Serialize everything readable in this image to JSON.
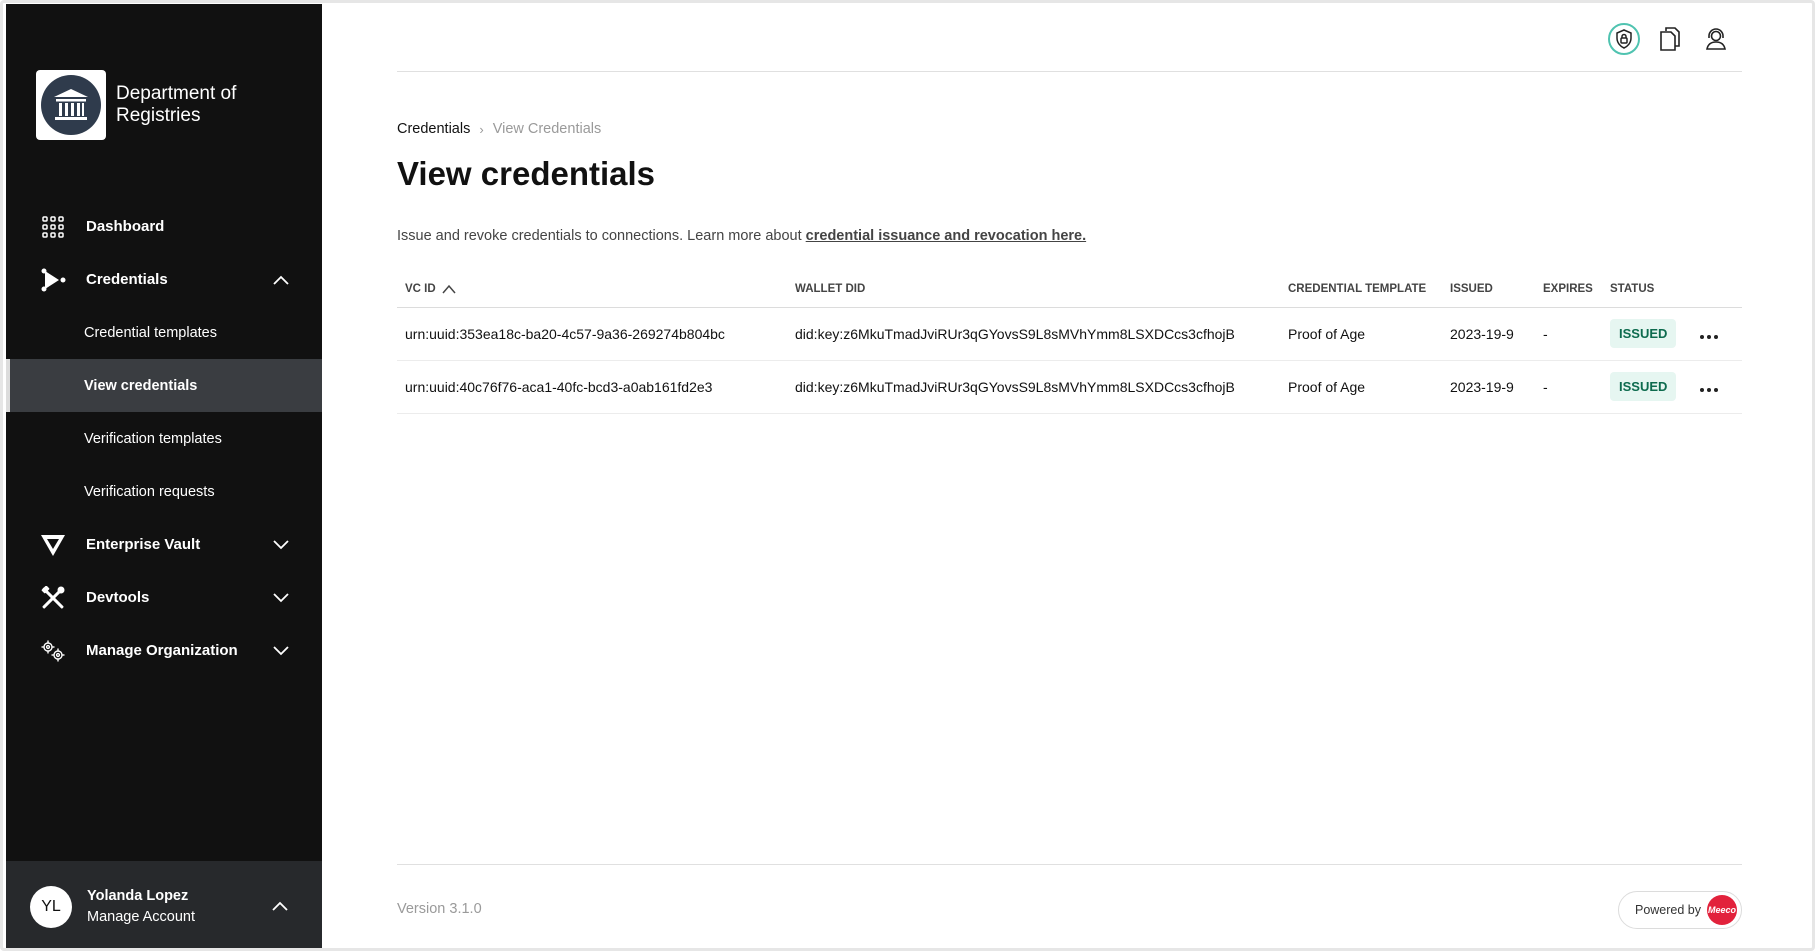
{
  "sidebar": {
    "org_name": "Department of Registries",
    "nav": {
      "dashboard": "Dashboard",
      "credentials": "Credentials",
      "credential_templates": "Credential templates",
      "view_credentials": "View credentials",
      "verification_templates": "Verification templates",
      "verification_requests": "Verification requests",
      "enterprise_vault": "Enterprise Vault",
      "devtools": "Devtools",
      "manage_organization": "Manage Organization"
    },
    "user": {
      "initials": "YL",
      "name": "Yolanda Lopez",
      "sub": "Manage Account"
    }
  },
  "header": {
    "icons": [
      "shield-lock-icon",
      "documents-icon",
      "user-support-icon"
    ]
  },
  "breadcrumb": {
    "root": "Credentials",
    "separator": "›",
    "current": "View Credentials"
  },
  "page": {
    "title": "View credentials",
    "description": "Issue and revoke credentials to connections. Learn more about ",
    "description_link": "credential issuance and revocation here."
  },
  "table": {
    "columns": [
      "VC ID",
      "WALLET DID",
      "CREDENTIAL TEMPLATE",
      "ISSUED",
      "EXPIRES",
      "STATUS"
    ],
    "rows": [
      {
        "vc_id": "urn:uuid:353ea18c-ba20-4c57-9a36-269274b804bc",
        "wallet_did": "did:key:z6MkuTmadJviRUr3qGYovsS9L8sMVhYmm8LSXDCcs3cfhojB",
        "template": "Proof of Age",
        "issued": "2023-19-9",
        "expires": "-",
        "status": "ISSUED"
      },
      {
        "vc_id": "urn:uuid:40c76f76-aca1-40fc-bcd3-a0ab161fd2e3",
        "wallet_did": "did:key:z6MkuTmadJviRUr3qGYovsS9L8sMVhYmm8LSXDCcs3cfhojB",
        "template": "Proof of Age",
        "issued": "2023-19-9",
        "expires": "-",
        "status": "ISSUED"
      }
    ]
  },
  "footer": {
    "version": "Version 3.1.0",
    "powered_by": "Powered by",
    "brand": "Meeco"
  },
  "colors": {
    "sidebar_bg": "#111111",
    "active_item_bg": "#3a3d41",
    "status_badge_bg": "#e6f6f1",
    "status_badge_text": "#0d6b4e",
    "brand_red": "#e2223c",
    "accent_teal": "#4fc3b0"
  }
}
